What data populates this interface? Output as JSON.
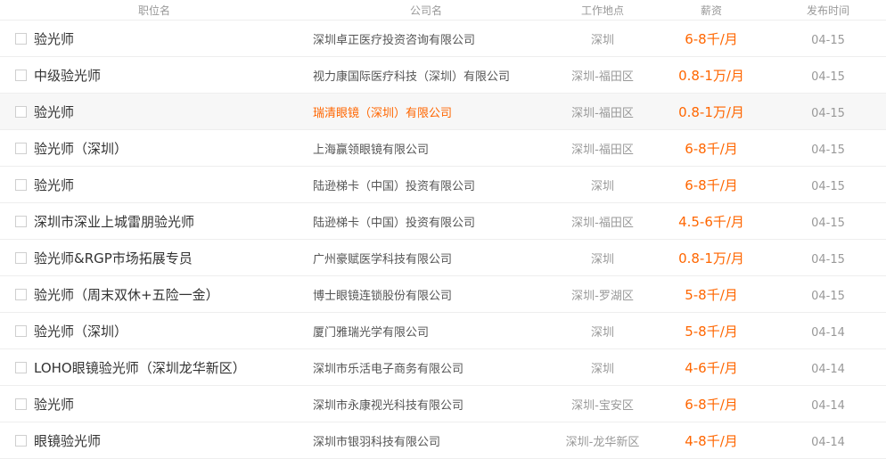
{
  "headers": {
    "position": "职位名",
    "company": "公司名",
    "location": "工作地点",
    "salary": "薪资",
    "date": "发布时间"
  },
  "accent_color": "#ff6600",
  "rows": [
    {
      "title": "验光师",
      "company": "深圳卓正医疗投资咨询有限公司",
      "location": "深圳",
      "salary": "6-8千/月",
      "date": "04-15"
    },
    {
      "title": "中级验光师",
      "company": "视力康国际医疗科技（深圳）有限公司",
      "location": "深圳-福田区",
      "salary": "0.8-1万/月",
      "date": "04-15"
    },
    {
      "title": "验光师",
      "company": "瑞清眼镜（深圳）有限公司",
      "location": "深圳-福田区",
      "salary": "0.8-1万/月",
      "date": "04-15"
    },
    {
      "title": "验光师（深圳）",
      "company": "上海赢领眼镜有限公司",
      "location": "深圳-福田区",
      "salary": "6-8千/月",
      "date": "04-15"
    },
    {
      "title": "验光师",
      "company": "陆逊梯卡（中国）投资有限公司",
      "location": "深圳",
      "salary": "6-8千/月",
      "date": "04-15"
    },
    {
      "title": "深圳市深业上城雷朋验光师",
      "company": "陆逊梯卡（中国）投资有限公司",
      "location": "深圳-福田区",
      "salary": "4.5-6千/月",
      "date": "04-15"
    },
    {
      "title": "验光师&RGP市场拓展专员",
      "company": "广州豪赋医学科技有限公司",
      "location": "深圳",
      "salary": "0.8-1万/月",
      "date": "04-15"
    },
    {
      "title": "验光师（周末双休+五险一金）",
      "company": "博士眼镜连锁股份有限公司",
      "location": "深圳-罗湖区",
      "salary": "5-8千/月",
      "date": "04-15"
    },
    {
      "title": "验光师（深圳）",
      "company": "厦门雅瑞光学有限公司",
      "location": "深圳",
      "salary": "5-8千/月",
      "date": "04-14"
    },
    {
      "title": "LOHO眼镜验光师（深圳龙华新区）",
      "company": "深圳市乐活电子商务有限公司",
      "location": "深圳",
      "salary": "4-6千/月",
      "date": "04-14"
    },
    {
      "title": "验光师",
      "company": "深圳市永康视光科技有限公司",
      "location": "深圳-宝安区",
      "salary": "6-8千/月",
      "date": "04-14"
    },
    {
      "title": "眼镜验光师",
      "company": "深圳市银羽科技有限公司",
      "location": "深圳-龙华新区",
      "salary": "4-8千/月",
      "date": "04-14"
    }
  ]
}
